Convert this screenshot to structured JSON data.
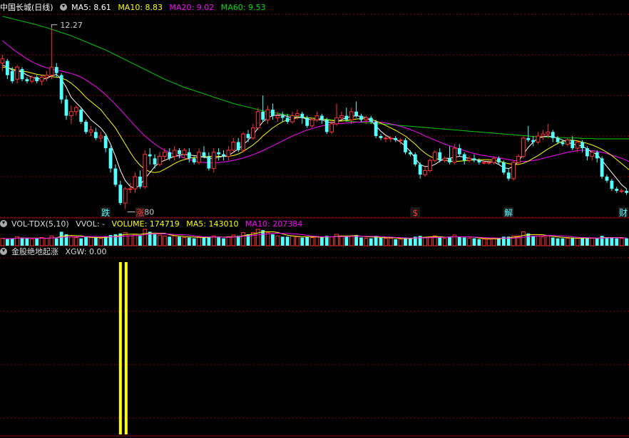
{
  "colors": {
    "up": "#ff3232",
    "down": "#54ffff",
    "ma5": "#ffffff",
    "ma10": "#ffff00",
    "ma20": "#ff00ff",
    "ma60": "#00c800",
    "grid": "#8b0000",
    "signal": "#ffff00",
    "label_text": "#ffffff"
  },
  "price_panel": {
    "title": "中国长城(日线)",
    "ma5_label": "MA5: 8.61",
    "ma10_label": "MA10: 8.83",
    "ma20_label": "MA20: 9.02",
    "ma60_label": "MA60: 9.53",
    "high_marker": "12.27",
    "low_marker": "7.80",
    "tags": [
      {
        "text": "跌",
        "color": "#54ffff"
      },
      {
        "text": "涨",
        "color": "#ff3232"
      },
      {
        "text": "$",
        "color": "#ff3232"
      },
      {
        "text": "解",
        "color": "#54ffff"
      },
      {
        "text": "财",
        "color": "#54ffff"
      }
    ]
  },
  "volume_panel": {
    "title": "VOL-TDX(5,10)",
    "vvol_label": "VVOL: -",
    "volume_label": "VOLUME: 174719",
    "ma5_label": "MA5: 143010",
    "ma10_label": "MA10: 207384"
  },
  "indicator_panel": {
    "title": "金股绝地起涨",
    "xgw_label": "XGW: 0.00"
  },
  "chart_data": {
    "type": "candlestick",
    "price_range": [
      7.6,
      12.6
    ],
    "candles": [
      [
        11.4,
        11.5,
        11.6,
        11.2
      ],
      [
        11.45,
        11.1,
        11.5,
        11.0
      ],
      [
        11.2,
        10.95,
        11.3,
        10.9
      ],
      [
        11.0,
        11.3,
        11.35,
        10.9
      ],
      [
        11.25,
        11.0,
        11.3,
        10.95
      ],
      [
        11.0,
        10.95,
        11.05,
        10.9
      ],
      [
        10.95,
        11.05,
        11.1,
        10.9
      ],
      [
        11.05,
        10.95,
        11.1,
        10.9
      ],
      [
        10.95,
        11.05,
        11.1,
        10.85
      ],
      [
        11.05,
        11.1,
        11.2,
        10.95
      ],
      [
        11.1,
        11.3,
        12.27,
        11.0
      ],
      [
        11.3,
        11.15,
        11.4,
        11.05
      ],
      [
        11.1,
        10.5,
        11.15,
        10.4
      ],
      [
        10.5,
        10.1,
        10.6,
        10.0
      ],
      [
        10.1,
        10.2,
        10.35,
        9.9
      ],
      [
        10.2,
        10.3,
        10.35,
        10.1
      ],
      [
        10.25,
        9.95,
        10.3,
        9.9
      ],
      [
        9.95,
        9.7,
        10.0,
        9.65
      ],
      [
        9.7,
        9.75,
        9.85,
        9.6
      ],
      [
        9.7,
        9.55,
        9.8,
        9.5
      ],
      [
        9.55,
        9.6,
        9.7,
        9.45
      ],
      [
        9.6,
        9.3,
        9.65,
        9.2
      ],
      [
        9.3,
        8.8,
        9.35,
        8.7
      ],
      [
        8.8,
        8.4,
        8.9,
        8.35
      ],
      [
        8.4,
        7.95,
        8.5,
        7.9
      ],
      [
        7.95,
        8.3,
        8.35,
        7.8
      ],
      [
        8.3,
        8.3,
        8.45,
        8.2
      ],
      [
        8.3,
        8.6,
        8.7,
        8.2
      ],
      [
        8.6,
        8.35,
        8.75,
        8.3
      ],
      [
        8.35,
        9.15,
        9.25,
        8.3
      ],
      [
        9.15,
        9.1,
        9.3,
        8.9
      ],
      [
        9.05,
        8.9,
        9.15,
        8.8
      ],
      [
        8.9,
        9.1,
        9.2,
        8.85
      ],
      [
        9.1,
        9.2,
        9.3,
        9.0
      ],
      [
        9.2,
        9.05,
        9.3,
        9.0
      ],
      [
        9.1,
        9.25,
        9.35,
        9.0
      ],
      [
        9.25,
        9.15,
        9.3,
        9.05
      ],
      [
        9.15,
        9.25,
        9.3,
        9.05
      ],
      [
        9.2,
        9.05,
        9.3,
        8.95
      ],
      [
        9.05,
        8.95,
        9.1,
        8.9
      ],
      [
        8.95,
        9.2,
        9.3,
        8.9
      ],
      [
        9.2,
        9.1,
        9.35,
        9.05
      ],
      [
        9.1,
        8.8,
        9.2,
        8.75
      ],
      [
        8.8,
        9.2,
        9.3,
        8.7
      ],
      [
        9.2,
        9.15,
        9.3,
        9.0
      ],
      [
        9.15,
        9.1,
        9.25,
        9.0
      ],
      [
        9.1,
        9.25,
        9.35,
        9.0
      ],
      [
        9.25,
        9.45,
        9.55,
        9.2
      ],
      [
        9.45,
        9.25,
        9.55,
        9.2
      ],
      [
        9.25,
        9.65,
        9.7,
        9.2
      ],
      [
        9.65,
        9.55,
        9.75,
        9.45
      ],
      [
        9.55,
        9.8,
        9.9,
        9.5
      ],
      [
        9.8,
        10.2,
        10.3,
        9.75
      ],
      [
        10.2,
        10.0,
        10.6,
        9.95
      ],
      [
        10.0,
        10.25,
        10.35,
        9.9
      ],
      [
        10.25,
        10.1,
        10.4,
        10.0
      ],
      [
        10.05,
        10.1,
        10.2,
        9.95
      ],
      [
        10.1,
        10.05,
        10.2,
        9.95
      ],
      [
        10.05,
        9.95,
        10.15,
        9.9
      ],
      [
        9.95,
        10.1,
        10.2,
        9.9
      ],
      [
        10.1,
        10.15,
        10.25,
        10.0
      ],
      [
        10.15,
        10.05,
        10.2,
        9.9
      ],
      [
        10.05,
        9.85,
        10.1,
        9.8
      ],
      [
        9.85,
        10.0,
        10.05,
        9.8
      ],
      [
        10.0,
        10.1,
        10.2,
        9.95
      ],
      [
        10.1,
        10.0,
        10.15,
        9.9
      ],
      [
        10.0,
        9.7,
        10.05,
        9.65
      ],
      [
        9.7,
        9.9,
        10.0,
        9.65
      ],
      [
        9.9,
        10.05,
        10.4,
        9.85
      ],
      [
        10.05,
        10.1,
        10.2,
        10.0
      ],
      [
        10.1,
        10.0,
        10.3,
        9.95
      ],
      [
        10.0,
        10.2,
        10.3,
        9.9
      ],
      [
        10.2,
        10.1,
        10.45,
        10.05
      ],
      [
        10.1,
        10.0,
        10.15,
        9.95
      ],
      [
        10.0,
        10.05,
        10.1,
        9.9
      ],
      [
        10.05,
        9.95,
        10.1,
        9.9
      ],
      [
        9.95,
        9.6,
        10.0,
        9.55
      ],
      [
        9.6,
        9.55,
        9.65,
        9.5
      ],
      [
        9.55,
        9.55,
        9.6,
        9.45
      ],
      [
        9.55,
        9.55,
        9.6,
        9.45
      ],
      [
        9.55,
        9.5,
        9.6,
        9.45
      ],
      [
        9.5,
        9.5,
        9.55,
        9.4
      ],
      [
        9.5,
        9.2,
        9.55,
        9.15
      ],
      [
        9.2,
        9.15,
        9.25,
        9.1
      ],
      [
        9.15,
        8.9,
        9.2,
        8.85
      ],
      [
        8.9,
        8.65,
        8.95,
        8.55
      ],
      [
        8.65,
        8.75,
        8.85,
        8.6
      ],
      [
        8.75,
        9.0,
        9.05,
        8.7
      ],
      [
        9.0,
        9.2,
        9.25,
        8.95
      ],
      [
        9.2,
        9.0,
        9.3,
        8.95
      ],
      [
        9.0,
        9.05,
        9.1,
        8.95
      ],
      [
        9.05,
        8.95,
        9.35,
        8.9
      ],
      [
        8.95,
        9.3,
        9.4,
        8.9
      ],
      [
        9.3,
        9.15,
        9.4,
        9.1
      ],
      [
        9.15,
        9.0,
        9.2,
        8.9
      ],
      [
        9.0,
        9.05,
        9.1,
        8.95
      ],
      [
        9.05,
        9.0,
        9.15,
        8.95
      ],
      [
        9.0,
        8.95,
        9.05,
        8.9
      ],
      [
        8.95,
        8.95,
        9.0,
        8.9
      ],
      [
        8.95,
        8.95,
        9.0,
        8.9
      ],
      [
        8.95,
        9.05,
        9.1,
        8.9
      ],
      [
        9.05,
        8.95,
        9.1,
        8.9
      ],
      [
        8.95,
        8.7,
        9.0,
        8.65
      ],
      [
        8.7,
        8.55,
        8.8,
        8.5
      ],
      [
        8.55,
        8.95,
        9.0,
        8.5
      ],
      [
        8.95,
        9.1,
        9.15,
        8.9
      ],
      [
        9.1,
        9.55,
        9.6,
        9.05
      ],
      [
        9.55,
        9.5,
        9.85,
        9.45
      ],
      [
        9.5,
        9.45,
        9.6,
        9.35
      ],
      [
        9.45,
        9.6,
        9.7,
        9.4
      ],
      [
        9.6,
        9.65,
        9.75,
        9.5
      ],
      [
        9.65,
        9.7,
        9.9,
        9.55
      ],
      [
        9.7,
        9.55,
        9.75,
        9.45
      ],
      [
        9.55,
        9.45,
        9.6,
        9.4
      ],
      [
        9.45,
        9.4,
        9.5,
        9.35
      ],
      [
        9.4,
        9.5,
        9.55,
        9.35
      ],
      [
        9.5,
        9.3,
        9.6,
        9.25
      ],
      [
        9.3,
        9.45,
        9.5,
        9.2
      ],
      [
        9.45,
        9.3,
        9.5,
        9.2
      ],
      [
        9.3,
        9.1,
        9.35,
        9.0
      ],
      [
        9.1,
        9.2,
        9.25,
        9.0
      ],
      [
        9.2,
        9.05,
        9.25,
        8.95
      ],
      [
        9.05,
        8.6,
        9.1,
        8.55
      ],
      [
        8.6,
        8.5,
        8.65,
        8.45
      ],
      [
        8.5,
        8.3,
        8.55,
        8.25
      ],
      [
        8.3,
        8.25,
        8.35,
        8.2
      ],
      [
        8.25,
        8.25,
        8.3,
        8.2
      ],
      [
        8.25,
        8.2,
        8.3,
        8.15
      ]
    ],
    "ma_lines": {
      "ma5": [
        11.35,
        11.3,
        11.22,
        11.2,
        11.18,
        11.1,
        11.05,
        11.02,
        11.0,
        11.02,
        11.08,
        11.12,
        11.0,
        10.8,
        10.55,
        10.42,
        10.3,
        10.15,
        10.0,
        9.9,
        9.8,
        9.65,
        9.4,
        9.1,
        8.75,
        8.5,
        8.36,
        8.3,
        8.4,
        8.55,
        8.7,
        8.85,
        8.95,
        9.0,
        9.05,
        9.1,
        9.12,
        9.15,
        9.13,
        9.12,
        9.1,
        9.08,
        9.05,
        9.05,
        9.08,
        9.1,
        9.12,
        9.2,
        9.28,
        9.38,
        9.5,
        9.62,
        9.8,
        9.95,
        10.05,
        10.1,
        10.12,
        10.12,
        10.08,
        10.05,
        10.06,
        10.05,
        10.02,
        10.0,
        10.0,
        10.0,
        9.95,
        9.93,
        9.95,
        10.0,
        10.05,
        10.08,
        10.1,
        10.08,
        10.05,
        9.98,
        9.85,
        9.72,
        9.62,
        9.55,
        9.52,
        9.45,
        9.35,
        9.22,
        9.05,
        8.9,
        8.85,
        8.85,
        8.9,
        8.98,
        9.05,
        9.05,
        9.08,
        9.1,
        9.08,
        9.05,
        9.02,
        9.0,
        8.98,
        8.97,
        8.96,
        8.9,
        8.82,
        8.8,
        8.85,
        8.98,
        9.15,
        9.32,
        9.45,
        9.55,
        9.58,
        9.6,
        9.58,
        9.55,
        9.5,
        9.45,
        9.4,
        9.38,
        9.35,
        9.28,
        9.2,
        9.15,
        9.0,
        8.85,
        8.7,
        8.55,
        8.4,
        8.3
      ],
      "ma10": [
        11.3,
        11.28,
        11.25,
        11.22,
        11.2,
        11.18,
        11.15,
        11.12,
        11.1,
        11.08,
        11.06,
        11.05,
        11.03,
        10.98,
        10.9,
        10.8,
        10.68,
        10.55,
        10.45,
        10.35,
        10.25,
        10.1,
        9.95,
        9.8,
        9.6,
        9.4,
        9.2,
        9.02,
        8.88,
        8.78,
        8.72,
        8.7,
        8.72,
        8.78,
        8.85,
        8.92,
        8.98,
        9.02,
        9.05,
        9.07,
        9.08,
        9.09,
        9.1,
        9.1,
        9.1,
        9.1,
        9.1,
        9.12,
        9.16,
        9.22,
        9.3,
        9.38,
        9.48,
        9.6,
        9.7,
        9.8,
        9.88,
        9.95,
        10.0,
        10.02,
        10.05,
        10.06,
        10.05,
        10.04,
        10.03,
        10.02,
        10.0,
        9.98,
        9.97,
        9.97,
        9.98,
        10.0,
        10.02,
        10.03,
        10.03,
        10.01,
        9.97,
        9.92,
        9.86,
        9.8,
        9.74,
        9.67,
        9.6,
        9.5,
        9.4,
        9.28,
        9.18,
        9.1,
        9.05,
        9.02,
        9.0,
        8.98,
        8.97,
        8.98,
        8.99,
        9.0,
        9.01,
        9.02,
        9.02,
        9.02,
        9.0,
        8.98,
        8.95,
        8.92,
        8.9,
        8.9,
        8.93,
        8.98,
        9.05,
        9.12,
        9.2,
        9.28,
        9.35,
        9.42,
        9.47,
        9.5,
        9.5,
        9.48,
        9.45,
        9.42,
        9.38,
        9.33,
        9.27,
        9.2,
        9.12,
        9.02,
        8.92,
        8.82,
        8.72,
        8.62
      ],
      "ma20": [
        11.95,
        11.85,
        11.75,
        11.66,
        11.58,
        11.5,
        11.43,
        11.37,
        11.32,
        11.28,
        11.25,
        11.22,
        11.2,
        11.17,
        11.14,
        11.1,
        11.05,
        10.98,
        10.9,
        10.82,
        10.72,
        10.62,
        10.5,
        10.38,
        10.25,
        10.12,
        9.98,
        9.85,
        9.72,
        9.6,
        9.5,
        9.4,
        9.32,
        9.25,
        9.2,
        9.15,
        9.1,
        9.06,
        9.02,
        8.99,
        8.96,
        8.95,
        8.94,
        8.94,
        8.95,
        8.96,
        8.98,
        9.0,
        9.03,
        9.06,
        9.1,
        9.14,
        9.19,
        9.24,
        9.3,
        9.36,
        9.42,
        9.48,
        9.54,
        9.6,
        9.65,
        9.7,
        9.75,
        9.78,
        9.82,
        9.85,
        9.87,
        9.89,
        9.9,
        9.91,
        9.92,
        9.93,
        9.94,
        9.95,
        9.96,
        9.96,
        9.95,
        9.94,
        9.92,
        9.9,
        9.87,
        9.84,
        9.8,
        9.76,
        9.71,
        9.66,
        9.6,
        9.55,
        9.5,
        9.45,
        9.4,
        9.36,
        9.32,
        9.28,
        9.24,
        9.2,
        9.17,
        9.14,
        9.12,
        9.1,
        9.08,
        9.06,
        9.04,
        9.02,
        9.0,
        8.98,
        8.97,
        8.98,
        9.0,
        9.02,
        9.05,
        9.08,
        9.11,
        9.14,
        9.17,
        9.2,
        9.22,
        9.24,
        9.25,
        9.25,
        9.24,
        9.22,
        9.2,
        9.17,
        9.13,
        9.09,
        9.05,
        9.0,
        8.95,
        8.9
      ],
      "ma60": [
        12.55,
        12.52,
        12.49,
        12.46,
        12.43,
        12.4,
        12.37,
        12.34,
        12.3,
        12.27,
        12.23,
        12.19,
        12.15,
        12.11,
        12.07,
        12.02,
        11.97,
        11.92,
        11.87,
        11.82,
        11.77,
        11.72,
        11.66,
        11.6,
        11.54,
        11.48,
        11.42,
        11.36,
        11.3,
        11.24,
        11.18,
        11.12,
        11.06,
        11.0,
        10.95,
        10.9,
        10.85,
        10.8,
        10.76,
        10.72,
        10.68,
        10.64,
        10.6,
        10.56,
        10.52,
        10.48,
        10.44,
        10.4,
        10.37,
        10.34,
        10.31,
        10.28,
        10.25,
        10.22,
        10.2,
        10.18,
        10.16,
        10.14,
        10.12,
        10.1,
        10.08,
        10.06,
        10.05,
        10.04,
        10.03,
        10.02,
        10.01,
        10.0,
        9.99,
        9.98,
        9.97,
        9.96,
        9.95,
        9.94,
        9.93,
        9.92,
        9.91,
        9.9,
        9.89,
        9.88,
        9.87,
        9.86,
        9.85,
        9.84,
        9.83,
        9.82,
        9.81,
        9.8,
        9.79,
        9.78,
        9.77,
        9.76,
        9.75,
        9.74,
        9.73,
        9.72,
        9.71,
        9.7,
        9.69,
        9.68,
        9.67,
        9.66,
        9.65,
        9.64,
        9.63,
        9.62,
        9.61,
        9.6,
        9.59,
        9.58,
        9.58,
        9.57,
        9.57,
        9.56,
        9.56,
        9.55,
        9.55,
        9.55,
        9.54,
        9.54,
        9.54,
        9.53,
        9.53,
        9.53,
        9.53,
        9.53,
        9.53,
        9.53,
        9.53,
        9.53
      ]
    },
    "volume": [
      0.45,
      0.4,
      0.45,
      0.55,
      0.5,
      0.45,
      0.4,
      0.45,
      0.5,
      0.45,
      0.6,
      0.45,
      0.85,
      0.7,
      0.55,
      0.5,
      0.45,
      0.55,
      0.5,
      0.5,
      0.45,
      0.55,
      0.65,
      0.7,
      0.75,
      0.8,
      0.6,
      0.7,
      0.6,
      1.0,
      0.85,
      0.7,
      0.65,
      0.6,
      0.55,
      0.6,
      0.55,
      0.5,
      0.5,
      0.45,
      0.55,
      0.5,
      0.55,
      0.6,
      0.5,
      0.45,
      0.55,
      0.65,
      0.6,
      0.8,
      0.7,
      0.8,
      1.0,
      0.95,
      0.8,
      0.7,
      0.6,
      0.55,
      0.55,
      0.6,
      0.55,
      0.5,
      0.55,
      0.5,
      0.55,
      0.5,
      0.6,
      0.55,
      0.7,
      0.6,
      0.55,
      0.6,
      0.65,
      0.5,
      0.45,
      0.45,
      0.6,
      0.5,
      0.45,
      0.45,
      0.4,
      0.4,
      0.5,
      0.45,
      0.55,
      0.6,
      0.5,
      0.55,
      0.6,
      0.5,
      0.45,
      0.55,
      0.65,
      0.55,
      0.5,
      0.45,
      0.45,
      0.4,
      0.4,
      0.4,
      0.45,
      0.45,
      0.55,
      0.55,
      0.6,
      0.6,
      0.85,
      0.75,
      0.6,
      0.6,
      0.55,
      0.6,
      0.5,
      0.45,
      0.45,
      0.45,
      0.5,
      0.45,
      0.45,
      0.5,
      0.45,
      0.45,
      0.6,
      0.5,
      0.5,
      0.45,
      0.45,
      0.45
    ],
    "signal_bars": {
      "x_index": 24,
      "value": 1
    },
    "labels": {
      "ma5": "MA5",
      "ma10": "MA10",
      "ma20": "MA20",
      "ma60": "MA60"
    }
  }
}
